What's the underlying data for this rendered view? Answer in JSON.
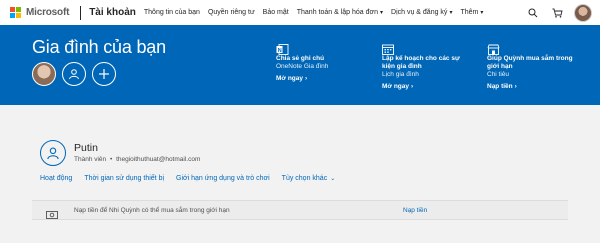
{
  "topnav": {
    "brand": "Microsoft",
    "section": "Tài khoản",
    "links": [
      {
        "label": "Thông tin của bạn",
        "dropdown": false
      },
      {
        "label": "Quyền riêng tư",
        "dropdown": false
      },
      {
        "label": "Bảo mật",
        "dropdown": false
      },
      {
        "label": "Thanh toán & lập hóa đơn",
        "dropdown": true
      },
      {
        "label": "Dịch vụ & đăng ký",
        "dropdown": true
      },
      {
        "label": "Thêm",
        "dropdown": true
      }
    ]
  },
  "banner": {
    "title": "Gia đình của bạn",
    "features": [
      {
        "icon": "onenote-icon",
        "title": "Chia sẻ ghi chú",
        "subtitle": "OneNote Gia đình",
        "link": "Mở ngay"
      },
      {
        "icon": "calendar-icon",
        "title": "Lập kế hoạch cho các sự kiện gia đình",
        "subtitle": "Lịch gia đình",
        "link": "Mở ngay"
      },
      {
        "icon": "store-icon",
        "title": "Giúp Quỳnh mua sắm trong giới hạn",
        "subtitle": "Chi tiêu",
        "link": "Nạp tiền"
      }
    ]
  },
  "member": {
    "name": "Putin",
    "role": "Thành viên",
    "separator": "•",
    "email": "thegioithuthuat@hotmail.com",
    "tabs": [
      {
        "label": "Hoạt động",
        "dropdown": false
      },
      {
        "label": "Thời gian sử dụng thiết bị",
        "dropdown": false
      },
      {
        "label": "Giới hạn ứng dụng và trò chơi",
        "dropdown": false
      },
      {
        "label": "Tùy chọn khác",
        "dropdown": true
      }
    ]
  },
  "spending_row": {
    "text": "Nạp tiền để Nhi Quỳnh có thể mua sắm trong giới hạn",
    "link": "Nạp tiền"
  },
  "colors": {
    "accent": "#0067b8",
    "banner": "#0067b8"
  }
}
